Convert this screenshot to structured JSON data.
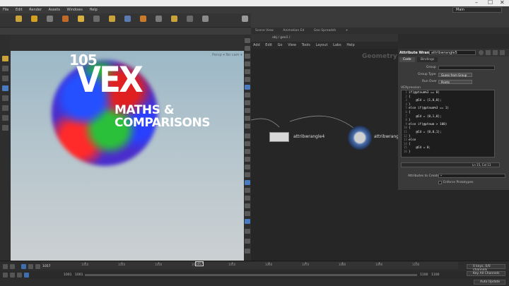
{
  "window": {
    "min": "–",
    "max": "☐",
    "close": "✕"
  },
  "menu": {
    "items": [
      "File",
      "Edit",
      "Render",
      "Assets",
      "Windows",
      "Help"
    ],
    "desktop": "Main"
  },
  "viewport": {
    "overlay_number": "105",
    "overlay_title": "VEX",
    "overlay_sub1": "MATHS &",
    "overlay_sub2": "COMPARISONS",
    "watermark": "Persp ▾  No cam ▾"
  },
  "network": {
    "tabs": [
      "Scene View",
      "Animation Ed",
      "Geo Spreadsh",
      "+"
    ],
    "path": "obj / geo1 /",
    "menu": [
      "Add",
      "Edit",
      "Go",
      "View",
      "Tools",
      "Layout",
      "Labs",
      "Help"
    ],
    "context_label": "Geometry",
    "node1_label": "attribwrangle4",
    "node2_label": "attribwrangle5"
  },
  "params": {
    "node_type": "Attribute Wrangle",
    "node_name": "attribwrangle5",
    "tabs": [
      "Code",
      "Bindings"
    ],
    "group_label": "Group",
    "group_value": "",
    "group_type_label": "Group Type",
    "group_type_value": "Guess from Group",
    "run_over_label": "Run Over",
    "run_over_value": "Points",
    "vexpression_label": "VEXpression",
    "code": [
      {
        "n": "1",
        "t": "if(@ptnum%3 == 0)"
      },
      {
        "n": "2",
        "t": "{"
      },
      {
        "n": "3",
        "t": "    @Cd = {1,0,0};"
      },
      {
        "n": "4",
        "t": "}"
      },
      {
        "n": "5",
        "t": "else if(@ptnum%3 == 1)"
      },
      {
        "n": "6",
        "t": "{"
      },
      {
        "n": "7",
        "t": "    @Cd = {0,1,0};"
      },
      {
        "n": "8",
        "t": "}"
      },
      {
        "n": "9",
        "t": "else if(@ptnum > 100)"
      },
      {
        "n": "10",
        "t": "{"
      },
      {
        "n": "11",
        "t": "    @Cd = {0,0,1};"
      },
      {
        "n": "12",
        "t": "}"
      },
      {
        "n": "13",
        "t": "else"
      },
      {
        "n": "14",
        "t": "{   "
      },
      {
        "n": "15",
        "t": "    @Cd = 0;"
      },
      {
        "n": "16",
        "t": "}"
      }
    ],
    "cursor_pos": "Ln 15, Col 13",
    "attrs_label": "Attributes to Create",
    "attrs_value": "*",
    "enforce_label": "Enforce Prototypes"
  },
  "timeline": {
    "current_frame": "1057",
    "frame_field": "1057",
    "start": "1001",
    "start2": "1001",
    "end": "1100",
    "end2": "1100",
    "ticks": [
      "1010",
      "1020",
      "1030",
      "1040",
      "1050",
      "1060",
      "1070",
      "1080",
      "1090",
      "1100"
    ],
    "keys_label": "0 keys, 0/0 channels",
    "key_all_label": "Key All Channels",
    "auto_update": "Auto Update"
  }
}
